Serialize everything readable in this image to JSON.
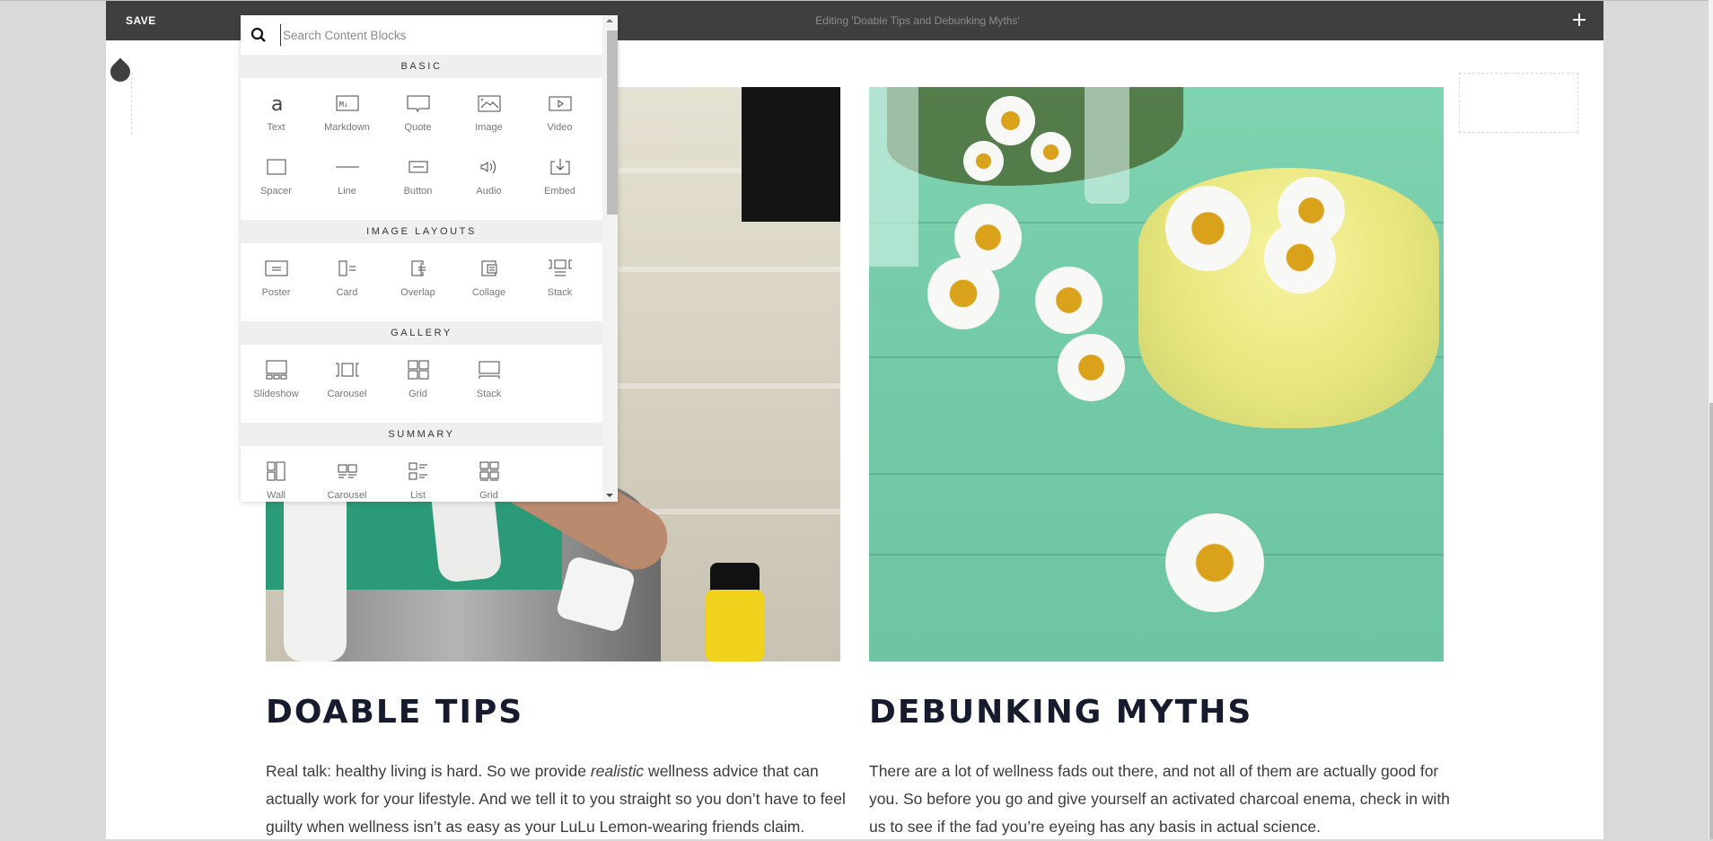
{
  "editor": {
    "save_label": "SAVE",
    "title": "Editing 'Doable Tips and Debunking Myths'",
    "add_icon": "plus-icon"
  },
  "picker": {
    "search_placeholder": "Search Content Blocks",
    "search_value": "",
    "search_icon": "search-icon",
    "sections": [
      {
        "title": "BASIC",
        "items": [
          {
            "label": "Text",
            "icon": "text-icon"
          },
          {
            "label": "Markdown",
            "icon": "markdown-icon"
          },
          {
            "label": "Quote",
            "icon": "quote-icon"
          },
          {
            "label": "Image",
            "icon": "image-icon"
          },
          {
            "label": "Video",
            "icon": "video-icon"
          },
          {
            "label": "Spacer",
            "icon": "spacer-icon"
          },
          {
            "label": "Line",
            "icon": "line-icon"
          },
          {
            "label": "Button",
            "icon": "button-icon"
          },
          {
            "label": "Audio",
            "icon": "audio-icon"
          },
          {
            "label": "Embed",
            "icon": "embed-icon"
          }
        ]
      },
      {
        "title": "IMAGE LAYOUTS",
        "items": [
          {
            "label": "Poster",
            "icon": "poster-icon"
          },
          {
            "label": "Card",
            "icon": "card-icon"
          },
          {
            "label": "Overlap",
            "icon": "overlap-icon"
          },
          {
            "label": "Collage",
            "icon": "collage-icon"
          },
          {
            "label": "Stack",
            "icon": "stack-layout-icon"
          }
        ]
      },
      {
        "title": "GALLERY",
        "items": [
          {
            "label": "Slideshow",
            "icon": "slideshow-icon"
          },
          {
            "label": "Carousel",
            "icon": "carousel-icon"
          },
          {
            "label": "Grid",
            "icon": "grid-icon"
          },
          {
            "label": "Stack",
            "icon": "stack-gallery-icon"
          }
        ]
      },
      {
        "title": "SUMMARY",
        "items": [
          {
            "label": "Wall",
            "icon": "wall-icon"
          },
          {
            "label": "Carousel",
            "icon": "summary-carousel-icon"
          },
          {
            "label": "List",
            "icon": "list-icon"
          },
          {
            "label": "Grid",
            "icon": "summary-grid-icon"
          }
        ]
      }
    ]
  },
  "content": {
    "cards": [
      {
        "image_alt": "Woman resting on stairs with towel and water bottle",
        "heading": "DOABLE TIPS",
        "body_before": "Real talk: healthy living is hard. So we provide ",
        "body_em": "realistic",
        "body_after": " wellness advice that can actually work for your lifestyle. And we tell it to you straight so you don’t have to feel guilty when wellness isn’t as easy as your LuLu Lemon-wearing friends claim."
      },
      {
        "image_alt": "Jar of yellow cream with chamomile flowers on green wood",
        "heading": "DEBUNKING MYTHS",
        "body": "There are a lot of wellness fads out there, and not all of them are actually good for you. So before you go and give yourself an activated charcoal enema, check in with us to see if the fad you’re eyeing has any basis in actual science."
      }
    ]
  },
  "colors": {
    "editbar": "#3f3f3f",
    "heading": "#161b2e",
    "body_text": "#3a3a3a",
    "section_header_bg": "#efefef"
  }
}
